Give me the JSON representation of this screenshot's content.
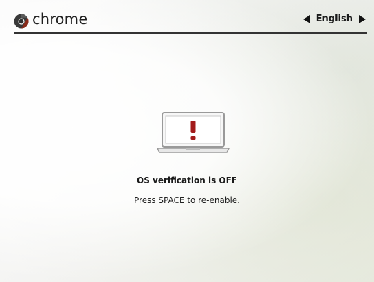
{
  "header": {
    "brand": "chrome",
    "language": "English"
  },
  "icons": {
    "logo": "chrome-logo-icon",
    "lang_prev": "left-arrow-icon",
    "lang_next": "right-arrow-icon",
    "illustration": "laptop-warning-icon"
  },
  "main": {
    "title": "OS verification is OFF",
    "message": "Press SPACE to re-enable."
  },
  "colors": {
    "warning": "#a31b1b",
    "text": "#1a1a1a"
  }
}
